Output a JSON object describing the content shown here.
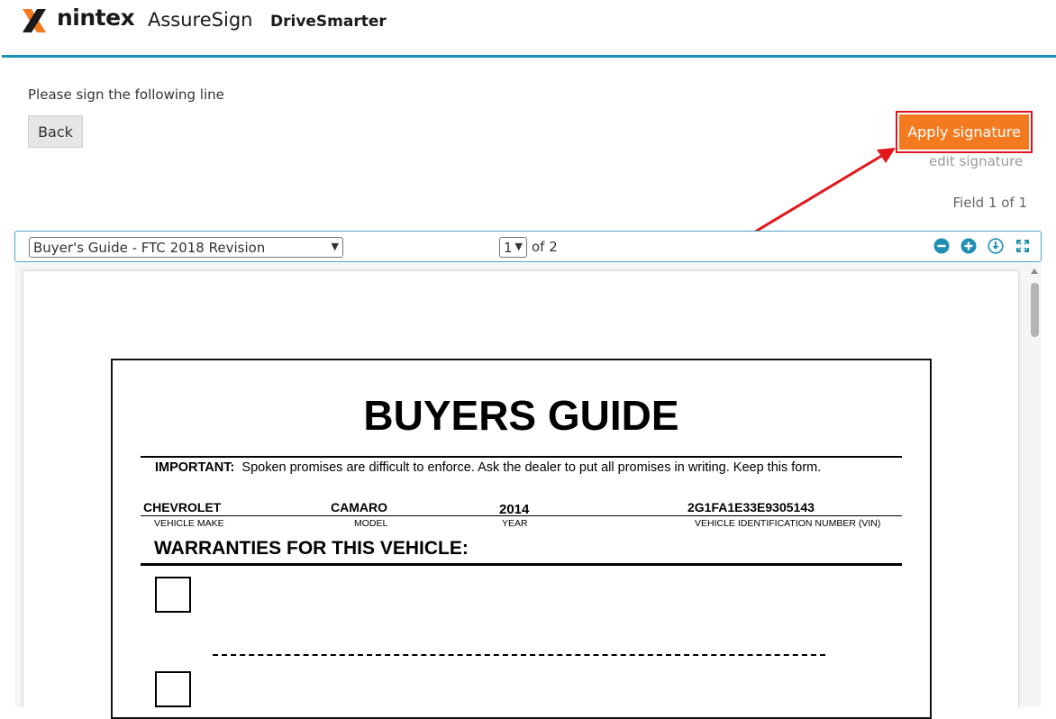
{
  "header": {
    "brand_primary": "nintex",
    "brand_product": "AssureSign",
    "brand_client": "DriveSmarter",
    "accent_color": "#1e8fb5",
    "logo_colors": [
      "#f47a20",
      "#1a1a1a"
    ]
  },
  "signing": {
    "instruction": "Please sign the following line",
    "back_label": "Back",
    "apply_label": "Apply signature",
    "apply_color": "#f47a20",
    "edit_label": "edit signature",
    "field_counter": "Field 1 of 1"
  },
  "toolbar": {
    "document_selected": "Buyer's Guide - FTC 2018 Revision",
    "page_selected": "1",
    "page_total_text": "of 2",
    "icons": [
      "zoom-out-icon",
      "zoom-in-icon",
      "download-icon",
      "fullscreen-icon"
    ]
  },
  "document": {
    "title": "BUYERS GUIDE",
    "important_label": "IMPORTANT:",
    "important_text": "Spoken promises are difficult to enforce.  Ask the dealer to put all promises in writing.  Keep this form.",
    "vehicle": {
      "make": "CHEVROLET",
      "make_label": "VEHICLE MAKE",
      "model": "CAMARO",
      "model_label": "MODEL",
      "year": "2014",
      "year_label": "YEAR",
      "vin": "2G1FA1E33E9305143",
      "vin_label": "VEHICLE IDENTIFICATION NUMBER (VIN)"
    },
    "warranties_heading": "WARRANTIES FOR THIS VEHICLE:"
  }
}
